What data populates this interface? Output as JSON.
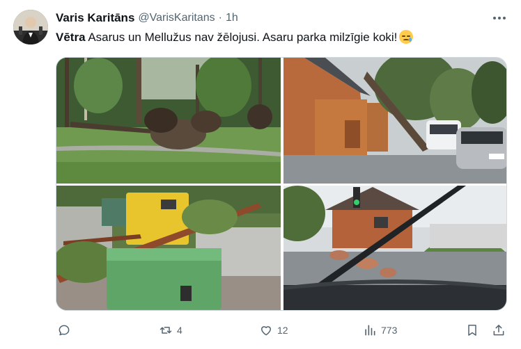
{
  "author": {
    "display_name": "Varis Karitāns",
    "handle": "@VarisKaritans",
    "separator": "·",
    "time": "1h"
  },
  "tweet": {
    "bold": "Vētra",
    "text": " Asarus un Mellužus nav žēlojusi. Asaru parka milzīgie koki!",
    "emoji": "sad-but-relieved-face"
  },
  "media": {
    "photos": [
      {
        "subject": "fallen-trees-in-park"
      },
      {
        "subject": "wooden-house-and-fallen-tree-on-street"
      },
      {
        "subject": "fallen-tree-on-dumpsters"
      },
      {
        "subject": "fallen-tree-seen-through-car-windshield"
      }
    ]
  },
  "actions": {
    "reply_count": "",
    "retweet_count": "4",
    "like_count": "12",
    "view_count": "773"
  },
  "icons": {
    "more": "more-icon",
    "reply": "reply-icon",
    "retweet": "retweet-icon",
    "like": "heart-icon",
    "views": "views-icon",
    "bookmark": "bookmark-icon",
    "share": "share-icon"
  },
  "colors": {
    "text": "#0f1419",
    "secondary": "#536471",
    "border": "#cfd9de"
  }
}
